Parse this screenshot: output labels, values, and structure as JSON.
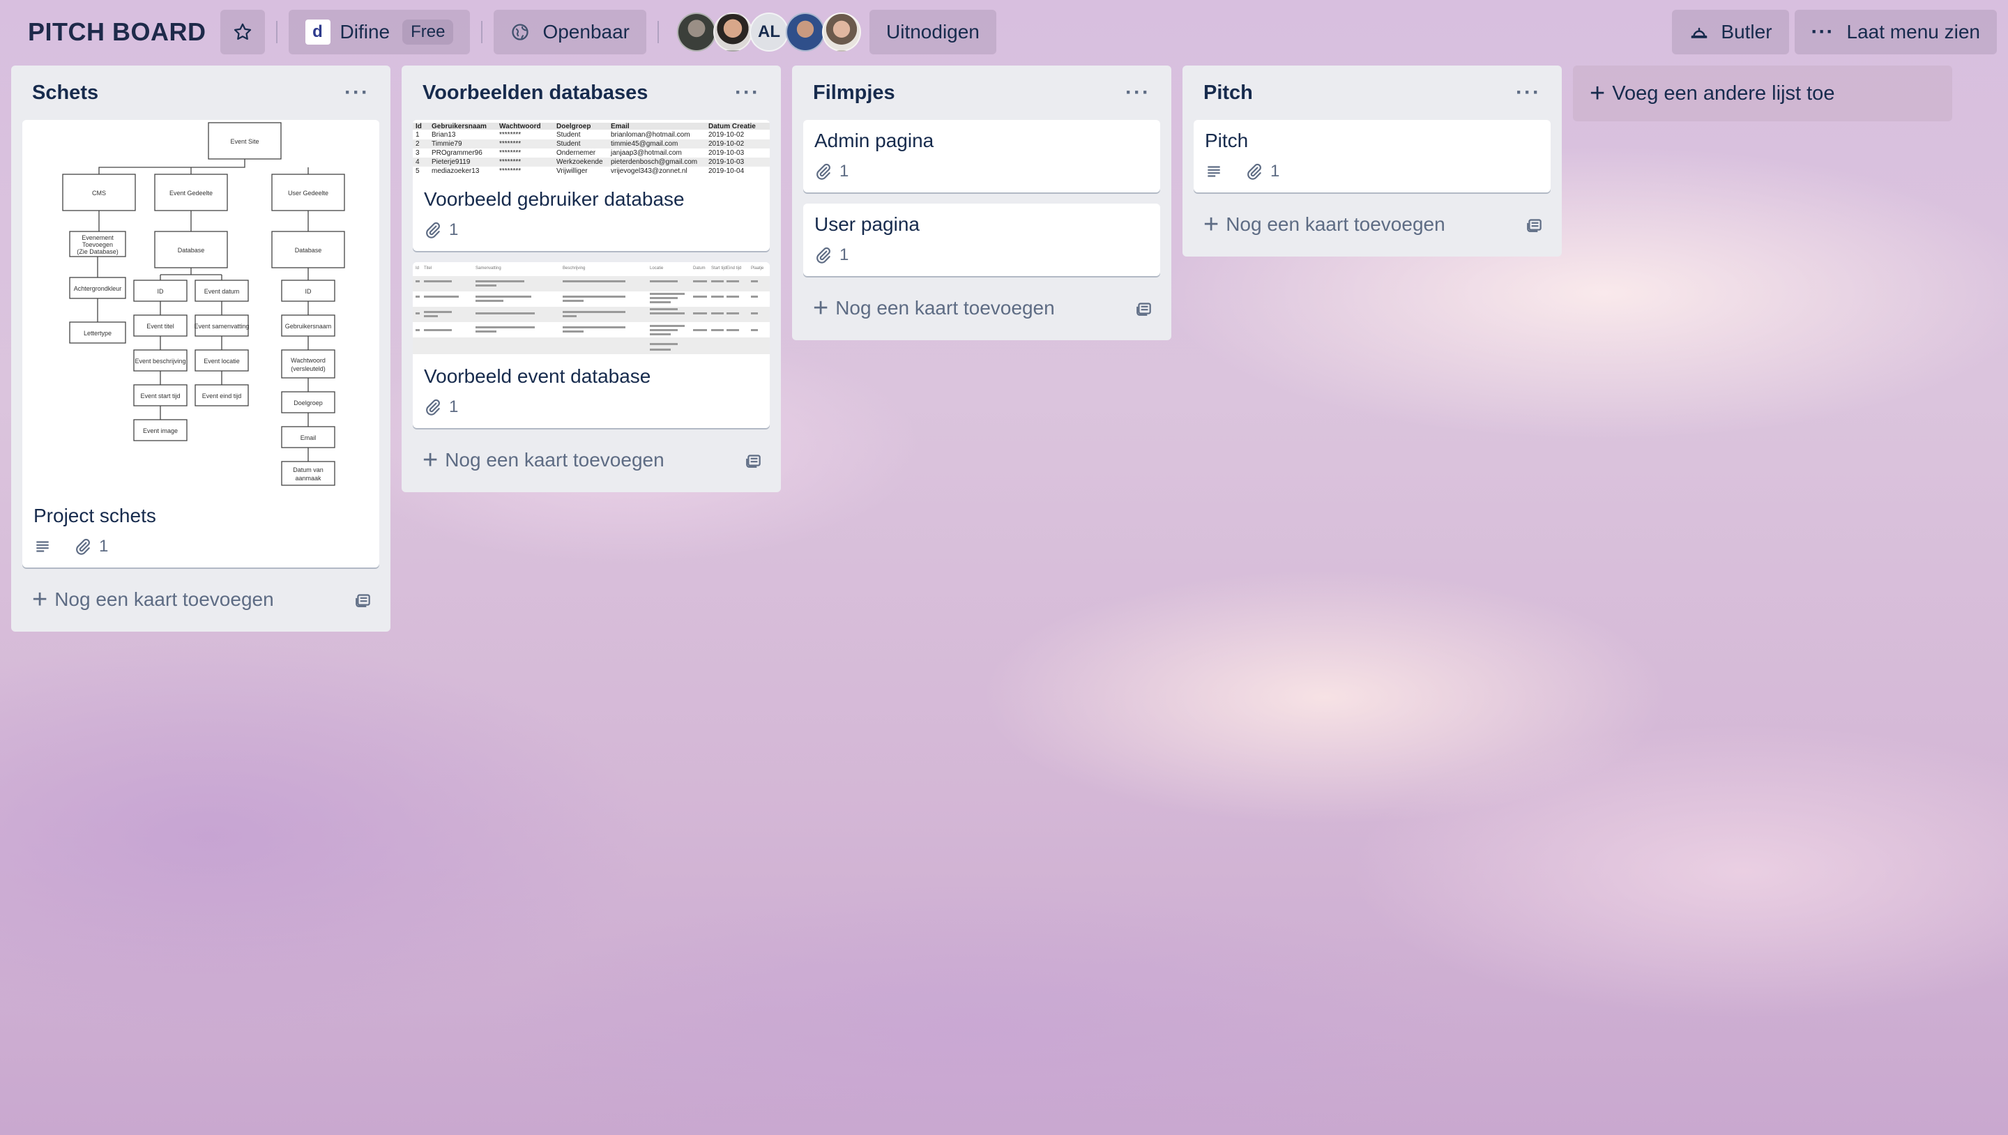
{
  "header": {
    "board_title": "PITCH BOARD",
    "star_icon": "star-icon",
    "team_logo_text": "d",
    "team_name": "Difine",
    "team_plan": "Free",
    "visibility_label": "Openbaar",
    "avatar_initials": "AL",
    "invite_label": "Uitnodigen",
    "butler_label": "Butler",
    "menu_label": "Laat menu zien"
  },
  "lists": [
    {
      "title": "Schets",
      "cards": [
        {
          "title": "Project schets",
          "attachments": "1",
          "has_description": true
        }
      ],
      "add_card_label": "Nog een kaart toevoegen"
    },
    {
      "title": "Voorbeelden databases",
      "cards": [
        {
          "title": "Voorbeeld gebruiker database",
          "attachments": "1"
        },
        {
          "title": "Voorbeeld event database",
          "attachments": "1"
        }
      ],
      "add_card_label": "Nog een kaart toevoegen"
    },
    {
      "title": "Filmpjes",
      "cards": [
        {
          "title": "Admin pagina",
          "attachments": "1"
        },
        {
          "title": "User pagina",
          "attachments": "1"
        }
      ],
      "add_card_label": "Nog een kaart toevoegen"
    },
    {
      "title": "Pitch",
      "cards": [
        {
          "title": "Pitch",
          "attachments": "1",
          "has_description": true
        }
      ],
      "add_card_label": "Nog een kaart toevoegen"
    }
  ],
  "add_list_label": "Voeg een andere lijst toe",
  "covers": {
    "sketch": {
      "boxes": [
        "Event Site",
        "CMS",
        "Event Gedeelte",
        "User Gedeelte",
        "Evenement Toevoegen (Zie Database)",
        "Database",
        "Database",
        "Achtergrondkleur",
        "ID",
        "Event datum",
        "ID",
        "Lettertype",
        "Event titel",
        "Event samenvatting",
        "Gebruikersnaam",
        "Event beschrijving",
        "Event locatie",
        "Wachtwoord (versleuteld)",
        "Event start tijd",
        "Event eind tijd",
        "Doelgroep",
        "Event image",
        "Email",
        "Datum van aanmaak"
      ]
    },
    "user_db": {
      "headers": [
        "Id",
        "Gebruikersnaam",
        "Wachtwoord",
        "Doelgroep",
        "Email",
        "Datum Creatie"
      ],
      "rows": [
        [
          "1",
          "Brian13",
          "********",
          "Student",
          "brianloman@hotmail.com",
          "2019-10-02"
        ],
        [
          "2",
          "Timmie79",
          "********",
          "Student",
          "timmie45@gmail.com",
          "2019-10-02"
        ],
        [
          "3",
          "PROgrammer96",
          "********",
          "Ondernemer",
          "janjaap3@hotmail.com",
          "2019-10-03"
        ],
        [
          "4",
          "Pieterje9119",
          "********",
          "Werkzoekende",
          "pieterdenbosch@gmail.com",
          "2019-10-03"
        ],
        [
          "5",
          "mediazoeker13",
          "********",
          "Vrijwilliger",
          "vrijevogel343@zonnet.nl",
          "2019-10-04"
        ]
      ]
    },
    "event_db": {
      "headers": [
        "Id",
        "Titel",
        "Samenvatting",
        "Beschrijving",
        "Locatie",
        "Datum",
        "Start tijd",
        "Eind tijd",
        "Plaatje"
      ]
    }
  }
}
